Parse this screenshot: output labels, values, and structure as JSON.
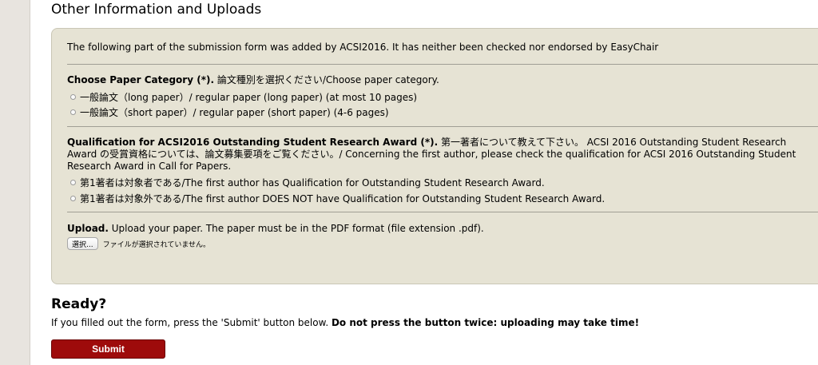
{
  "section_title": "Other Information and Uploads",
  "panel": {
    "intro": "The following part of the submission form was added by ACSI2016. It has neither been checked nor endorsed by EasyChair",
    "paper_category": {
      "label_bold": "Choose Paper Category (*).",
      "label_rest": " 論文種別を選択ください/Choose paper category.",
      "options": [
        "一般論文（long paper）/ regular paper (long paper) (at most 10 pages)",
        "一般論文（short paper）/ regular paper (short paper) (4-6 pages)"
      ]
    },
    "qualification": {
      "label_bold": "Qualification for ACSI2016 Outstanding Student Research Award (*).",
      "label_rest": " 第一著者について教えて下さい。 ACSI 2016 Outstanding Student Research Award の受賞資格については、論文募集要項をご覧ください。/ Concerning the first author, please check the qualification for ACSI 2016 Outstanding Student Research Award in Call for Papers.",
      "options": [
        "第1著者は対象者である/The first author has Qualification for Outstanding Student Research Award.",
        "第1著者は対象外である/The first author DOES NOT have Qualification for Outstanding Student Research Award."
      ]
    },
    "upload": {
      "label_bold": "Upload.",
      "label_rest": " Upload your paper. The paper must be in the PDF format (file extension .pdf).",
      "button_label": "選択...",
      "no_file_text": "ファイルが選択されていません。"
    }
  },
  "ready": {
    "title": "Ready?",
    "text_plain": "If you filled out the form, press the 'Submit' button below. ",
    "text_bold": "Do not press the button twice: uploading may take time!",
    "submit_label": "Submit"
  },
  "colors": {
    "panel_bg": "#e6e3d4",
    "submit_bg": "#9e0b0b",
    "left_rail": "#e8e4df"
  }
}
